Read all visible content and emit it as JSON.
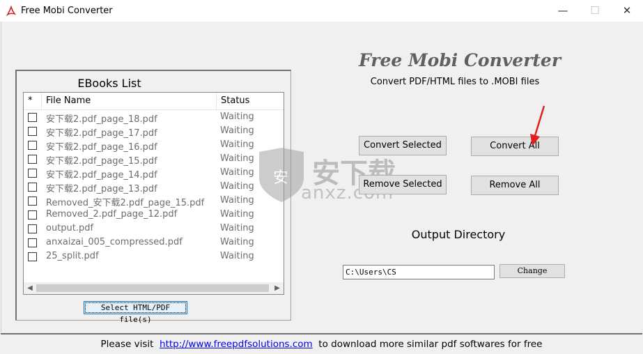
{
  "window": {
    "title": "Free Mobi Converter"
  },
  "ebooks": {
    "title": "EBooks List",
    "columns": [
      "*",
      "File Name",
      "Status"
    ],
    "rows": [
      {
        "name": "安下载2.pdf_page_18.pdf",
        "status": "Waiting"
      },
      {
        "name": "安下载2.pdf_page_17.pdf",
        "status": "Waiting"
      },
      {
        "name": "安下载2.pdf_page_16.pdf",
        "status": "Waiting"
      },
      {
        "name": "安下载2.pdf_page_15.pdf",
        "status": "Waiting"
      },
      {
        "name": "安下载2.pdf_page_14.pdf",
        "status": "Waiting"
      },
      {
        "name": "安下载2.pdf_page_13.pdf",
        "status": "Waiting"
      },
      {
        "name": "Removed_安下载2.pdf_page_15.pdf",
        "status": "Waiting"
      },
      {
        "name": "Removed_2.pdf_page_12.pdf",
        "status": "Waiting"
      },
      {
        "name": "output.pdf",
        "status": "Waiting"
      },
      {
        "name": "anxaizai_005_compressed.pdf",
        "status": "Waiting"
      },
      {
        "name": "25_split.pdf",
        "status": "Waiting"
      }
    ],
    "select_button": "Select HTML/PDF file(s)"
  },
  "brand": {
    "title": "Free Mobi Converter",
    "subtitle": "Convert PDF/HTML files to .MOBI files"
  },
  "actions": {
    "convert_selected": "Convert Selected",
    "convert_all": "Convert All",
    "remove_selected": "Remove Selected",
    "remove_all": "Remove All"
  },
  "output": {
    "label": "Output Directory",
    "path": "C:\\Users\\CS",
    "change": "Change"
  },
  "watermark": {
    "text": "anxz.com"
  },
  "footer": {
    "prefix": "Please visit",
    "link": "http://www.freepdfsolutions.com",
    "suffix": "to download more similar pdf softwares for free"
  },
  "colors": {
    "link": "#0000ee",
    "arrow": "#e02020",
    "brand": "#606060"
  }
}
